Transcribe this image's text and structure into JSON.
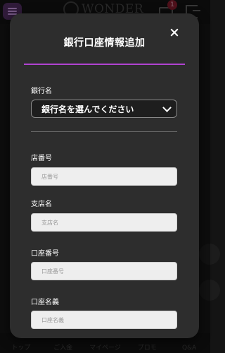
{
  "header": {
    "logo_text": "WONDER",
    "mail_badge": "1"
  },
  "bottom_nav": [
    "トップ",
    "ご入金",
    "マイページ",
    "プロモ",
    "Q&A"
  ],
  "modal": {
    "title": "銀行口座情報追加",
    "bank_name": {
      "label": "銀行名",
      "selected": "銀行名を選んでください"
    },
    "branch_number": {
      "label": "店番号",
      "placeholder": "店番号"
    },
    "branch_name": {
      "label": "支店名",
      "placeholder": "支店名"
    },
    "account_number": {
      "label": "口座番号",
      "placeholder": "口座番号"
    },
    "account_holder": {
      "label": "口座名義",
      "placeholder": "口座名義"
    }
  },
  "colors": {
    "accent": "#b043d1",
    "modal_bg": "#2d2d2d",
    "input_bg": "#eeeeee"
  },
  "icons": [
    "menu-icon",
    "mail-icon",
    "logout-icon",
    "close-icon",
    "chevron-down-icon"
  ]
}
